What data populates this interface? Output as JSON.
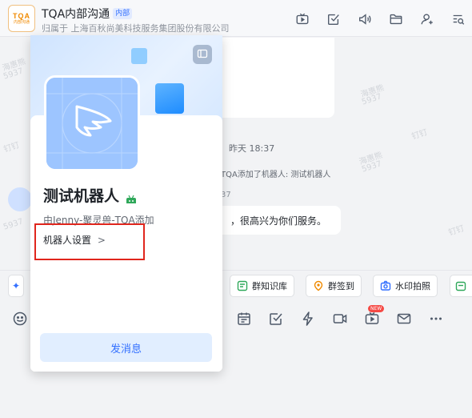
{
  "header": {
    "logo_text": "TQA",
    "logo_sub": "内部沟通",
    "title": "TQA内部沟通",
    "badge": "内部",
    "subtitle": "归属于 上海百秋尚美科技服务集团股份有限公司",
    "icons": [
      "tv-icon",
      "checkbox-icon",
      "announcement-icon",
      "folder-icon",
      "add-member-icon",
      "search-list-icon"
    ]
  },
  "chat": {
    "time": "昨天 18:37",
    "system_message": "TQA添加了机器人: 测试机器人",
    "message_time": "37",
    "bubble_text": "，很高兴为你们服务。",
    "watermarks": [
      "海惠熊",
      "5937",
      "钉钉"
    ]
  },
  "quickbar": {
    "items": [
      {
        "label": "群知识库",
        "icon": "knowledge-icon",
        "color": "#2fa85a"
      },
      {
        "label": "群签到",
        "icon": "checkin-icon",
        "color": "#f08a00"
      },
      {
        "label": "水印拍照",
        "icon": "camera-icon",
        "color": "#3370ff"
      }
    ]
  },
  "toolbar": {
    "icons": [
      "emoji-icon",
      "calendar-icon",
      "todo-icon",
      "lightning-icon",
      "video-icon",
      "live-icon",
      "mail-icon",
      "more-icon"
    ],
    "new_badge": "NEW"
  },
  "popup": {
    "name": "测试机器人",
    "added_by": "由Jenny-聚灵兽-TQA添加",
    "settings_label": "机器人设置",
    "settings_chevron": ">",
    "send_button": "发消息"
  }
}
